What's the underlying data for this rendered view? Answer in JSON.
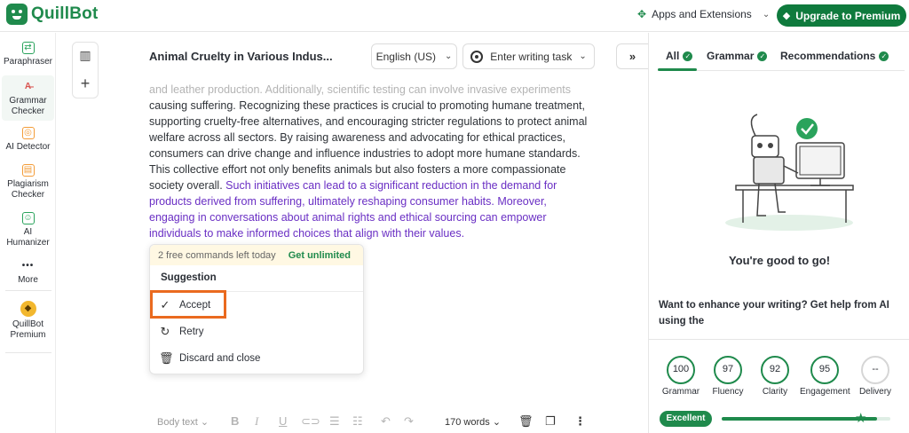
{
  "app": {
    "name": "QuillBot"
  },
  "topbar": {
    "apps_label": "Apps and Extensions",
    "upgrade_label": "Upgrade to Premium"
  },
  "sidebar": {
    "items": [
      {
        "label": "Paraphraser",
        "icon": "paraphraser-icon"
      },
      {
        "label": "Grammar\nChecker",
        "icon": "grammar-checker-icon"
      },
      {
        "label": "AI Detector",
        "icon": "ai-detector-icon"
      },
      {
        "label": "Plagiarism\nChecker",
        "icon": "plagiarism-icon"
      },
      {
        "label": "AI\nHumanizer",
        "icon": "humanizer-icon"
      },
      {
        "label": "More",
        "icon": "more-icon"
      },
      {
        "label": "QuillBot\nPremium",
        "icon": "premium-diamond-icon"
      }
    ]
  },
  "editor": {
    "title": "Animal Cruelty in Various Indus...",
    "language": "English (US)",
    "task_placeholder": "Enter writing task",
    "text_faded": "and leather production. Additionally, scientific testing can involve invasive experiments",
    "text_normal": "causing suffering. Recognizing these practices is crucial to promoting humane treatment, supporting cruelty-free alternatives, and encouraging stricter regulations to protect animal welfare across all sectors. By raising awareness and advocating for ethical practices, consumers can drive change and influence industries to adopt more humane standards. This collective effort not only benefits animals but also fosters a more compassionate society overall.",
    "text_suggested": "Such initiatives can lead to a significant reduction in the demand for products derived from suffering, ultimately reshaping consumer habits. Moreover, engaging in conversations about animal rights and ethical sourcing can empower individuals to make informed choices that align with their values."
  },
  "popup": {
    "free_commands": "2 free commands left today",
    "get_unlimited": "Get unlimited",
    "heading": "Suggestion",
    "accept": "Accept",
    "retry": "Retry",
    "discard": "Discard and close"
  },
  "bottombar": {
    "style": "Body text",
    "word_count": "170 words"
  },
  "right_panel": {
    "tabs": [
      {
        "label": "All"
      },
      {
        "label": "Grammar"
      },
      {
        "label": "Recommendations"
      }
    ],
    "status": "You're good to go!",
    "enhance_text": "Want to enhance your writing? Get help from AI using the",
    "scores": [
      {
        "label": "Grammar",
        "value": "100"
      },
      {
        "label": "Fluency",
        "value": "97"
      },
      {
        "label": "Clarity",
        "value": "92"
      },
      {
        "label": "Engagement",
        "value": "95"
      },
      {
        "label": "Delivery",
        "value": "--"
      }
    ],
    "overall_label": "Excellent",
    "overall_progress": 0.92
  },
  "colors": {
    "brand_green": "#1f8a4c",
    "suggestion_purple": "#6a2fc4",
    "highlight_orange": "#ea6a1f"
  }
}
